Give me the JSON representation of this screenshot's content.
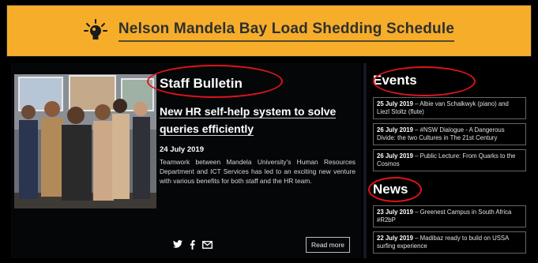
{
  "banner": {
    "title": "Nelson Mandela Bay Load Shedding Schedule",
    "bulb_icon": "lightbulb-icon",
    "background": "#f5ad2a"
  },
  "staff_bulletin": {
    "title": "Staff Bulletin",
    "article": {
      "title": "New HR self-help system to solve queries efficiently",
      "date": "24 July 2019",
      "text": "Teamwork between Mandela University's Human Resources Department and ICT Services has led to an exciting new venture with various benefits for both staff and the HR team.",
      "photo": "staff-group-photo"
    },
    "social_icons": [
      "twitter-icon",
      "facebook-icon",
      "email-icon"
    ],
    "read_more": "Read more"
  },
  "events": {
    "title": "Events",
    "items": [
      {
        "date": "25 July 2019",
        "text": " – Albie van Schalkwyk (piano) and Liezl Stoltz (flute)"
      },
      {
        "date": "26 July 2019",
        "text": " – #NSW Dialogue - A Dangerous Divide: the two Cultures in The 21st Century"
      },
      {
        "date": "26 July 2019",
        "text": " – Public Lecture: From Quarks to the Cosmos"
      }
    ]
  },
  "news": {
    "title": "News",
    "items": [
      {
        "date": "23 July 2019",
        "text": " – Greenest Campus in South Africa #R2bP"
      },
      {
        "date": "22 July 2019",
        "text": " – Madibaz ready to build on USSA surfing experience"
      }
    ]
  },
  "colors": {
    "highlight_oval": "#e0131b",
    "page_background": "#000000"
  }
}
